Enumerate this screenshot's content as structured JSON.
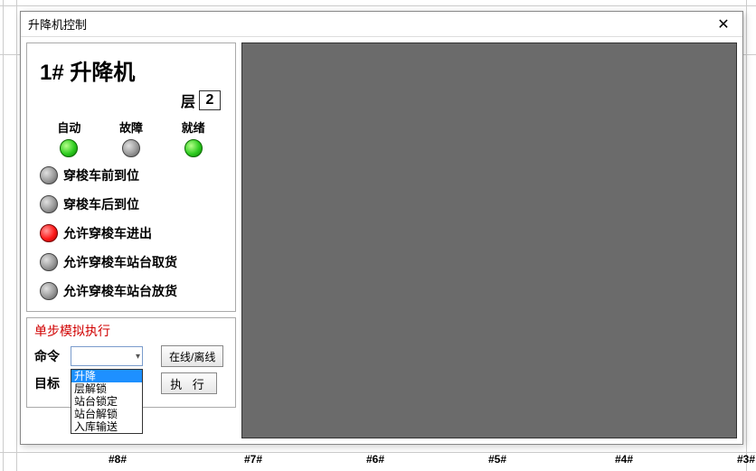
{
  "dialog": {
    "title": "升降机控制"
  },
  "lift": {
    "title": "1# 升降机",
    "floor_label": "层",
    "floor_value": "2"
  },
  "top_status": [
    {
      "label": "自动",
      "state": "green"
    },
    {
      "label": "故障",
      "state": "off"
    },
    {
      "label": "就绪",
      "state": "green"
    }
  ],
  "status_items": [
    {
      "label": "穿梭车前到位",
      "state": "off"
    },
    {
      "label": "穿梭车后到位",
      "state": "off"
    },
    {
      "label": "允许穿梭车进出",
      "state": "red"
    },
    {
      "label": "允许穿梭车站台取货",
      "state": "off"
    },
    {
      "label": "允许穿梭车站台放货",
      "state": "off"
    }
  ],
  "sim": {
    "title": "单步模拟执行",
    "command_label": "命令",
    "command_value": "",
    "target_label": "目标",
    "target_value": "",
    "online_button": "在线/离线",
    "execute_button": "执 行",
    "dropdown_options": [
      "升降",
      "层解锁",
      "站台锁定",
      "站台解锁",
      "入库输送"
    ],
    "dropdown_selected_index": 0
  },
  "bg_columns": [
    "#8#",
    "#7#",
    "#6#",
    "#5#",
    "#4#",
    "#3#"
  ]
}
